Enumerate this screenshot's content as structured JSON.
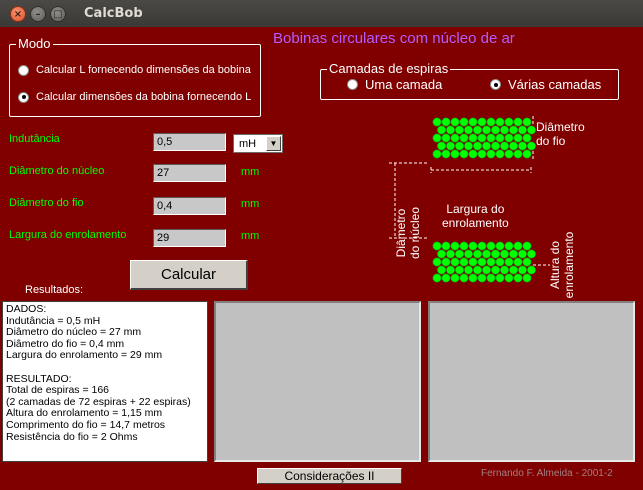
{
  "window": {
    "title": "CalcBob"
  },
  "heading": "Bobinas circulares com núcleo de ar",
  "mode_group": {
    "legend": "Modo",
    "options": [
      {
        "label": "Calcular L fornecendo dimensões da bobina",
        "checked": false
      },
      {
        "label": "Calcular dimensões da bobina fornecendo L",
        "checked": true
      }
    ]
  },
  "layers_group": {
    "legend": "Camadas de espiras",
    "options": [
      {
        "label": "Uma camada",
        "checked": false
      },
      {
        "label": "Várias camadas",
        "checked": true
      }
    ]
  },
  "fields": [
    {
      "label": "Indutância",
      "value": "0,5"
    },
    {
      "label": "Diâmetro do núcleo",
      "value": "27",
      "unit": "mm"
    },
    {
      "label": "Diâmetro do fio",
      "value": "0,4",
      "unit": "mm"
    },
    {
      "label": "Largura do enrolamento",
      "value": "29",
      "unit": "mm"
    }
  ],
  "unit_select": {
    "value": "mH"
  },
  "calculate_button": "Calcular",
  "results_label": "Resultados:",
  "results_text": "DADOS:\nIndutância = 0,5 mH\nDiâmetro do núcleo = 27 mm\nDiâmetro do fio = 0,4 mm\nLargura do enrolamento = 29 mm\n\nRESULTADO:\nTotal de espiras = 166\n(2 camadas de 72 espiras + 22 espiras)\nAltura do enrolamento = 1,15 mm\nComprimento do fio = 14,7 metros\nResistência do fio = 2 Ohms",
  "diagram_labels": {
    "wire_diameter": "Diâmetro\ndo fio",
    "winding_width": "Largura do\nenrolamento",
    "core_diameter": "Diâmetro\ndo núcleo",
    "winding_height": "Altura do\nenrolamento"
  },
  "considerations_button": "Considerações II",
  "credit": "Fernando F. Almeida - 2001-2",
  "colors": {
    "background": "#800000",
    "labels": "#00ff00",
    "heading": "#b25cff",
    "wire": "#00ff00"
  },
  "icons": {
    "close": "close-icon",
    "minimize": "minimize-icon",
    "maximize": "maximize-icon"
  }
}
